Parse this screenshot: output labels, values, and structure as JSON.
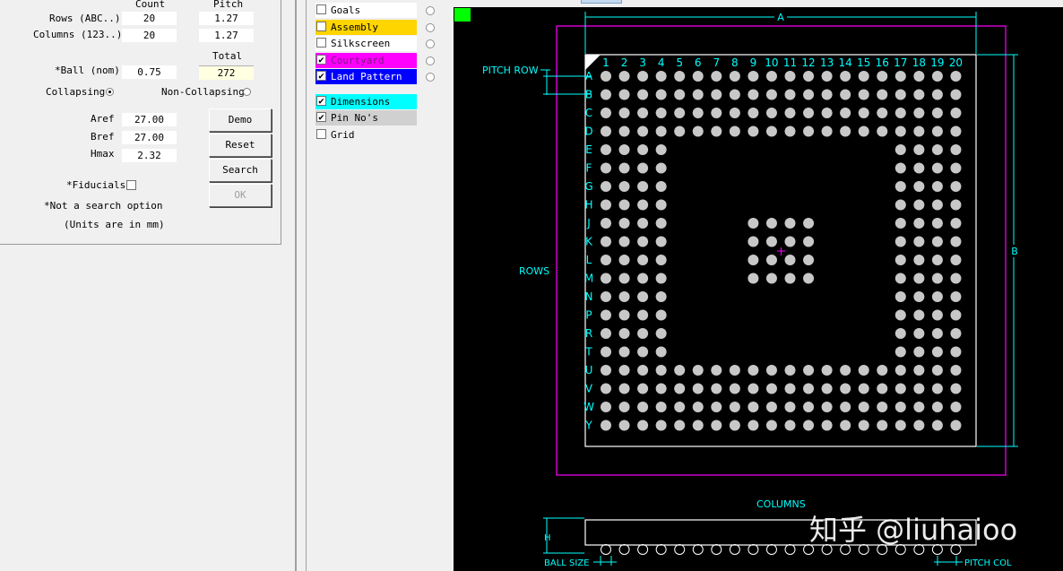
{
  "params": {
    "count_header": "Count",
    "pitch_header": "Pitch",
    "rows_label": "Rows (ABC..)",
    "rows_count": "20",
    "rows_pitch": "1.27",
    "columns_label": "Columns (123..)",
    "columns_count": "20",
    "columns_pitch": "1.27",
    "total_header": "Total",
    "ball_label": "*Ball (nom)",
    "ball_value": "0.75",
    "total_value": "272",
    "collapsing_label": "Collapsing",
    "noncollapsing_label": "Non-Collapsing",
    "aref_label": "Aref",
    "aref_value": "27.00",
    "bref_label": "Bref",
    "bref_value": "27.00",
    "hmax_label": "Hmax",
    "hmax_value": "2.32",
    "fiducials_label": "*Fiducials",
    "note_search": "*Not a search option",
    "note_units": "(Units are in mm)"
  },
  "buttons": {
    "demo": "Demo",
    "reset": "Reset",
    "search": "Search",
    "ok": "OK"
  },
  "layers": [
    {
      "label": "Goals",
      "bg": "#ffffff",
      "fg": "#000000",
      "checked": false
    },
    {
      "label": "Assembly",
      "bg": "#ffd500",
      "fg": "#000000",
      "checked": false
    },
    {
      "label": "Silkscreen",
      "bg": "#ffffff",
      "fg": "#000000",
      "checked": false
    },
    {
      "label": "Courtyard",
      "bg": "#ff00ff",
      "fg": "#7a1a7a",
      "checked": true
    },
    {
      "label": "Land Pattern",
      "bg": "#0000ff",
      "fg": "#ffffff",
      "checked": true
    },
    {
      "label": "Dimensions",
      "bg": "#00ffff",
      "fg": "#000000",
      "checked": true
    },
    {
      "label": "Pin No's",
      "bg": "#d0d0d0",
      "fg": "#000000",
      "checked": true
    },
    {
      "label": "Grid",
      "bg": "#f0f0f0",
      "fg": "#000000",
      "checked": false
    }
  ],
  "drawing": {
    "dim_a": "A",
    "dim_b": "B",
    "pitch_row": "PITCH ROW",
    "rows": "ROWS",
    "columns": "COLUMNS",
    "h": "H",
    "ball_size": "BALL SIZE",
    "pitch_col": "PITCH COL",
    "col_numbers": [
      "1",
      "2",
      "3",
      "4",
      "5",
      "6",
      "7",
      "8",
      "9",
      "10",
      "11",
      "12",
      "13",
      "14",
      "15",
      "16",
      "17",
      "18",
      "19",
      "20"
    ],
    "row_letters": [
      "A",
      "B",
      "C",
      "D",
      "E",
      "F",
      "G",
      "H",
      "J",
      "K",
      "L",
      "M",
      "N",
      "P",
      "R",
      "T",
      "U",
      "V",
      "W",
      "Y"
    ],
    "colors": {
      "background": "#000000",
      "dimension": "#00ffff",
      "courtyard": "#ff00ff",
      "outline": "#ffffff",
      "ball": "#c8c8c8",
      "marker": "#00ff00"
    }
  },
  "watermark": "知乎 @liuhaioo"
}
